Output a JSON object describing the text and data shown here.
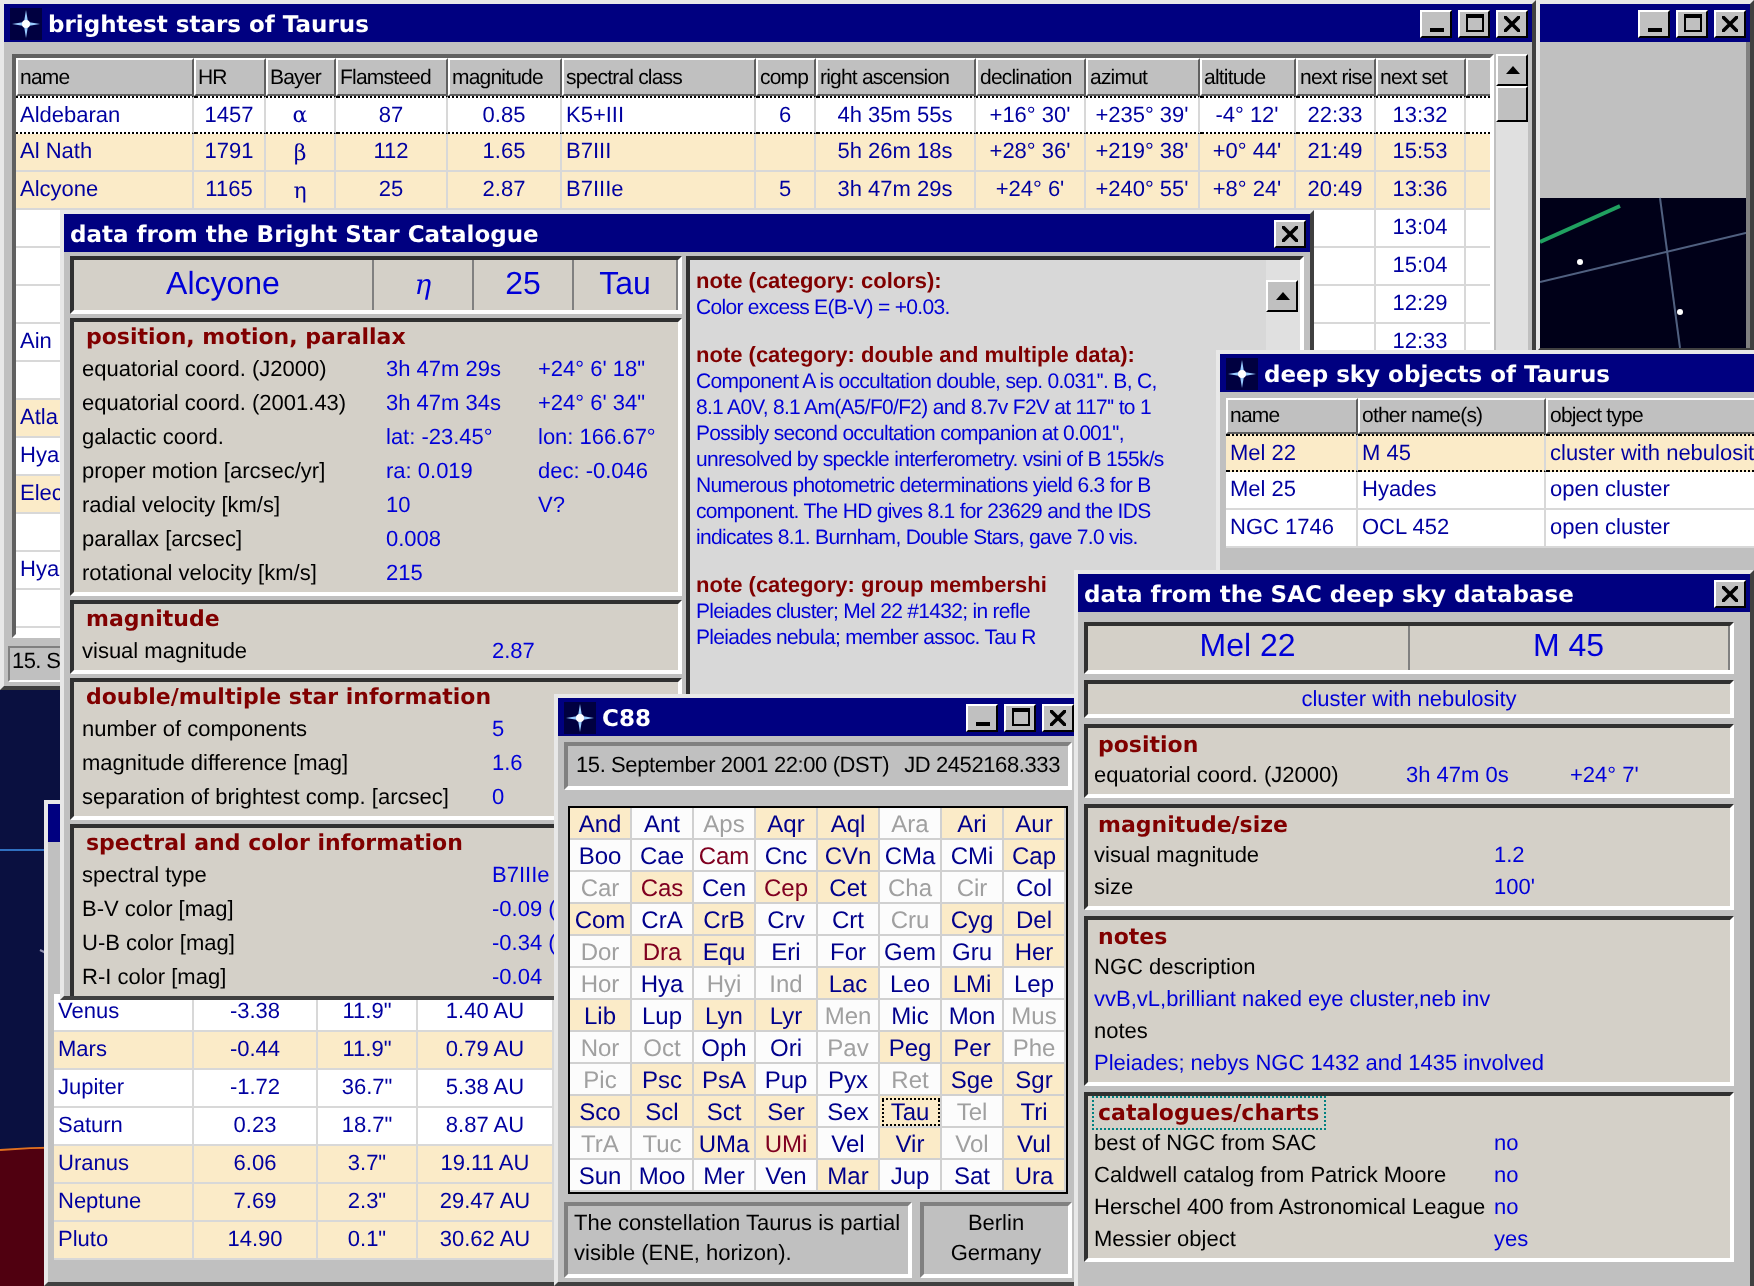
{
  "stars_window": {
    "title": "brightest stars of Taurus",
    "columns": [
      "name",
      "HR",
      "Bayer",
      "Flamsteed",
      "magnitude",
      "spectral class",
      "comp",
      "right ascension",
      "declination",
      "azimut",
      "altitude",
      "next rise",
      "next set"
    ],
    "rows": [
      {
        "selected": true,
        "shaded": false,
        "cells": [
          "Aldebaran",
          "1457",
          "α",
          "87",
          "0.85",
          "K5+III",
          "6",
          "4h 35m 55s",
          "+16° 30'",
          "+235° 39'",
          "-4° 12'",
          "22:33",
          "13:32"
        ]
      },
      {
        "selected": false,
        "shaded": true,
        "cells": [
          "Al Nath",
          "1791",
          "β",
          "112",
          "1.65",
          "B7III",
          null,
          "5h 26m 18s",
          "+28° 36'",
          "+219° 38'",
          "+0° 44'",
          "21:49",
          "15:53"
        ]
      },
      {
        "selected": false,
        "shaded": true,
        "cells": [
          "Alcyone",
          "1165",
          "η",
          "25",
          "2.87",
          "B7IIIe",
          "5",
          "3h 47m 29s",
          "+24° 6'",
          "+240° 55'",
          "+8° 24'",
          "20:49",
          "13:36"
        ]
      },
      {
        "selected": false,
        "shaded": false,
        "cells": [
          null,
          null,
          null,
          null,
          null,
          null,
          null,
          null,
          null,
          null,
          null,
          null,
          "13:04"
        ]
      },
      {
        "selected": false,
        "shaded": false,
        "cells": [
          null,
          null,
          null,
          null,
          null,
          null,
          null,
          null,
          null,
          null,
          null,
          null,
          "15:04"
        ]
      },
      {
        "selected": false,
        "shaded": false,
        "cells": [
          null,
          null,
          null,
          null,
          null,
          null,
          null,
          null,
          null,
          null,
          null,
          null,
          "12:29"
        ]
      },
      {
        "selected": false,
        "shaded": false,
        "cells": [
          "Ain",
          null,
          null,
          null,
          null,
          null,
          null,
          null,
          null,
          null,
          null,
          null,
          "12:33"
        ]
      },
      {
        "selected": false,
        "shaded": false,
        "cells": []
      },
      {
        "selected": false,
        "shaded": true,
        "cells": [
          "Atla"
        ]
      },
      {
        "selected": false,
        "shaded": false,
        "cells": [
          "Hya"
        ]
      },
      {
        "selected": false,
        "shaded": true,
        "cells": [
          "Elec"
        ]
      },
      {
        "selected": false,
        "shaded": false,
        "cells": []
      },
      {
        "selected": false,
        "shaded": false,
        "cells": [
          "Hya"
        ]
      },
      {
        "selected": false,
        "shaded": false,
        "cells": []
      }
    ],
    "status": "15. S"
  },
  "planets_window": {
    "rows": [
      {
        "shaded": false,
        "cells": [
          "Venus",
          "-3.38",
          "11.9\"",
          "1.40 AU"
        ]
      },
      {
        "shaded": true,
        "cells": [
          "Mars",
          "-0.44",
          "11.9\"",
          "0.79 AU"
        ]
      },
      {
        "shaded": false,
        "cells": [
          "Jupiter",
          "-1.72",
          "36.7\"",
          "5.38 AU"
        ]
      },
      {
        "shaded": false,
        "cells": [
          "Saturn",
          "0.23",
          "18.7\"",
          "8.87 AU"
        ]
      },
      {
        "shaded": true,
        "cells": [
          "Uranus",
          "6.06",
          "3.7\"",
          "19.11 AU"
        ]
      },
      {
        "shaded": true,
        "cells": [
          "Neptune",
          "7.69",
          "2.3\"",
          "29.47 AU"
        ]
      },
      {
        "shaded": true,
        "cells": [
          "Pluto",
          "14.90",
          "0.1\"",
          "30.62 AU"
        ]
      }
    ]
  },
  "bsc_window": {
    "title": "data from the Bright Star Catalogue",
    "header": [
      "Alcyone",
      "η",
      "25",
      "Tau"
    ],
    "sections": [
      {
        "heading": "position, motion, parallax",
        "rows": [
          [
            "equatorial coord. (J2000)",
            "3h 47m 29s",
            "+24° 6' 18\""
          ],
          [
            "equatorial coord. (2001.43)",
            "3h 47m 34s",
            "+24° 6' 34\""
          ],
          [
            "galactic coord.",
            "lat: -23.45°",
            "lon: 166.67°"
          ],
          [
            "proper motion [arcsec/yr]",
            "ra: 0.019",
            "dec: -0.046"
          ],
          [
            "radial velocity [km/s]",
            "10",
            "V?"
          ],
          [
            "parallax [arcsec]",
            "0.008"
          ],
          [
            "rotational velocity [km/s]",
            "215"
          ]
        ]
      },
      {
        "heading": "magnitude",
        "rows": [
          [
            "visual magnitude",
            "2.87"
          ]
        ]
      },
      {
        "heading": "double/multiple star information",
        "rows": [
          [
            "number of components",
            "5"
          ],
          [
            "magnitude difference [mag]",
            "1.6"
          ],
          [
            "separation of brightest comp. [arcsec]",
            "0"
          ]
        ]
      },
      {
        "heading": "spectral and color information",
        "rows": [
          [
            "spectral type",
            "B7IIIe"
          ],
          [
            "B-V color [mag]",
            "-0.09 ("
          ],
          [
            "U-B color [mag]",
            "-0.34 ("
          ],
          [
            "R-I color [mag]",
            "-0.04"
          ]
        ]
      }
    ],
    "notes": [
      {
        "heading": "note (category: colors):",
        "lines": [
          "Color excess E(B-V) = +0.03."
        ]
      },
      {
        "heading": "note (category: double and multiple data):",
        "lines": [
          "Component A is occultation double, sep. 0.031''. B, C,",
          "8.1 A0V, 8.1 Am(A5/F0/F2) and 8.7v F2V at 117'' to 1",
          "Possibly second occultation companion at 0.001'',",
          "unresolved by speckle interferometry. vsini of B 155k/s",
          "Numerous photometric determinations yield 6.3 for B",
          "component.  The HD gives 8.1 for 23629 and the IDS",
          "indicates 8.1.  Burnham, Double Stars, gave 7.0 vis."
        ]
      },
      {
        "heading": "note (category: group membershi",
        "lines": [
          "Pleiades cluster; Mel 22 #1432; in refle",
          "Pleiades nebula; member assoc. Tau R"
        ]
      }
    ]
  },
  "deepsky_window": {
    "title": "deep sky objects of Taurus",
    "columns": [
      "name",
      "other name(s)",
      "object type"
    ],
    "rows": [
      {
        "selected": true,
        "shaded": true,
        "cells": [
          "Mel  22",
          "M  45",
          "cluster with nebulosit"
        ]
      },
      {
        "selected": false,
        "shaded": false,
        "cells": [
          "Mel  25",
          "Hyades",
          "open cluster"
        ]
      },
      {
        "selected": false,
        "shaded": false,
        "cells": [
          "NGC 1746",
          "OCL  452",
          "open cluster"
        ]
      }
    ]
  },
  "sac_window": {
    "title": "data from the SAC deep sky database",
    "header": [
      "Mel  22",
      "M  45"
    ],
    "object_type": "cluster with nebulosity",
    "sections": [
      {
        "heading": "position",
        "focused": false,
        "rows": [
          {
            "kind": "triple",
            "cells": [
              "equatorial coord. (J2000)",
              "3h 47m 0s",
              "+24° 7'"
            ]
          }
        ]
      },
      {
        "heading": "magnitude/size",
        "focused": false,
        "rows": [
          {
            "kind": "pair",
            "cells": [
              "visual magnitude",
              "1.2"
            ]
          },
          {
            "kind": "pair",
            "cells": [
              "size",
              "100'"
            ]
          }
        ]
      },
      {
        "heading": "notes",
        "focused": false,
        "rows": [
          {
            "kind": "caption",
            "cells": [
              "NGC description"
            ]
          },
          {
            "kind": "value",
            "cells": [
              "vvB,vL,brilliant naked eye cluster,neb inv"
            ]
          },
          {
            "kind": "caption",
            "cells": [
              "notes"
            ]
          },
          {
            "kind": "value",
            "cells": [
              "Pleiades; nebys NGC 1432 and 1435 involved"
            ]
          }
        ]
      },
      {
        "heading": "catalogues/charts",
        "focused": true,
        "rows": [
          {
            "kind": "wide",
            "cells": [
              "best of NGC from SAC",
              "no"
            ]
          },
          {
            "kind": "wide",
            "cells": [
              "Caldwell catalog from Patrick Moore",
              "no"
            ]
          },
          {
            "kind": "wide",
            "cells": [
              "Herschel 400 from Astronomical League",
              "no"
            ]
          },
          {
            "kind": "wide",
            "cells": [
              "Messier object",
              "yes"
            ]
          }
        ]
      }
    ]
  },
  "c88_window": {
    "title": "C88",
    "date": "15. September 2001 22:00 (DST)",
    "julian_date": "JD 2452168.333",
    "cells": [
      {
        "label": "And",
        "dimmed": false,
        "emphasized": false,
        "shaded": true,
        "selected": false
      },
      {
        "label": "Ant",
        "dimmed": false,
        "emphasized": false,
        "shaded": false,
        "selected": false
      },
      {
        "label": "Aps",
        "dimmed": true,
        "emphasized": false,
        "shaded": false,
        "selected": false
      },
      {
        "label": "Aqr",
        "dimmed": false,
        "emphasized": false,
        "shaded": true,
        "selected": false
      },
      {
        "label": "Aql",
        "dimmed": false,
        "emphasized": false,
        "shaded": true,
        "selected": false
      },
      {
        "label": "Ara",
        "dimmed": true,
        "emphasized": false,
        "shaded": false,
        "selected": false
      },
      {
        "label": "Ari",
        "dimmed": false,
        "emphasized": false,
        "shaded": true,
        "selected": false
      },
      {
        "label": "Aur",
        "dimmed": false,
        "emphasized": false,
        "shaded": true,
        "selected": false
      },
      {
        "label": "Boo",
        "dimmed": false,
        "emphasized": false,
        "shaded": false,
        "selected": false
      },
      {
        "label": "Cae",
        "dimmed": false,
        "emphasized": false,
        "shaded": false,
        "selected": false
      },
      {
        "label": "Cam",
        "dimmed": false,
        "emphasized": true,
        "shaded": false,
        "selected": false
      },
      {
        "label": "Cnc",
        "dimmed": false,
        "emphasized": false,
        "shaded": false,
        "selected": false
      },
      {
        "label": "CVn",
        "dimmed": false,
        "emphasized": false,
        "shaded": true,
        "selected": false
      },
      {
        "label": "CMa",
        "dimmed": false,
        "emphasized": false,
        "shaded": false,
        "selected": false
      },
      {
        "label": "CMi",
        "dimmed": false,
        "emphasized": false,
        "shaded": false,
        "selected": false
      },
      {
        "label": "Cap",
        "dimmed": false,
        "emphasized": false,
        "shaded": true,
        "selected": false
      },
      {
        "label": "Car",
        "dimmed": true,
        "emphasized": false,
        "shaded": false,
        "selected": false
      },
      {
        "label": "Cas",
        "dimmed": false,
        "emphasized": true,
        "shaded": true,
        "selected": false
      },
      {
        "label": "Cen",
        "dimmed": false,
        "emphasized": false,
        "shaded": false,
        "selected": false
      },
      {
        "label": "Cep",
        "dimmed": false,
        "emphasized": true,
        "shaded": true,
        "selected": false
      },
      {
        "label": "Cet",
        "dimmed": false,
        "emphasized": false,
        "shaded": true,
        "selected": false
      },
      {
        "label": "Cha",
        "dimmed": true,
        "emphasized": false,
        "shaded": false,
        "selected": false
      },
      {
        "label": "Cir",
        "dimmed": true,
        "emphasized": false,
        "shaded": false,
        "selected": false
      },
      {
        "label": "Col",
        "dimmed": false,
        "emphasized": false,
        "shaded": false,
        "selected": false
      },
      {
        "label": "Com",
        "dimmed": false,
        "emphasized": false,
        "shaded": true,
        "selected": false
      },
      {
        "label": "CrA",
        "dimmed": false,
        "emphasized": false,
        "shaded": false,
        "selected": false
      },
      {
        "label": "CrB",
        "dimmed": false,
        "emphasized": false,
        "shaded": true,
        "selected": false
      },
      {
        "label": "Crv",
        "dimmed": false,
        "emphasized": false,
        "shaded": false,
        "selected": false
      },
      {
        "label": "Crt",
        "dimmed": false,
        "emphasized": false,
        "shaded": false,
        "selected": false
      },
      {
        "label": "Cru",
        "dimmed": true,
        "emphasized": false,
        "shaded": false,
        "selected": false
      },
      {
        "label": "Cyg",
        "dimmed": false,
        "emphasized": false,
        "shaded": true,
        "selected": false
      },
      {
        "label": "Del",
        "dimmed": false,
        "emphasized": false,
        "shaded": true,
        "selected": false
      },
      {
        "label": "Dor",
        "dimmed": true,
        "emphasized": false,
        "shaded": false,
        "selected": false
      },
      {
        "label": "Dra",
        "dimmed": false,
        "emphasized": true,
        "shaded": true,
        "selected": false
      },
      {
        "label": "Equ",
        "dimmed": false,
        "emphasized": false,
        "shaded": true,
        "selected": false
      },
      {
        "label": "Eri",
        "dimmed": false,
        "emphasized": false,
        "shaded": false,
        "selected": false
      },
      {
        "label": "For",
        "dimmed": false,
        "emphasized": false,
        "shaded": false,
        "selected": false
      },
      {
        "label": "Gem",
        "dimmed": false,
        "emphasized": false,
        "shaded": false,
        "selected": false
      },
      {
        "label": "Gru",
        "dimmed": false,
        "emphasized": false,
        "shaded": false,
        "selected": false
      },
      {
        "label": "Her",
        "dimmed": false,
        "emphasized": false,
        "shaded": true,
        "selected": false
      },
      {
        "label": "Hor",
        "dimmed": true,
        "emphasized": false,
        "shaded": false,
        "selected": false
      },
      {
        "label": "Hya",
        "dimmed": false,
        "emphasized": false,
        "shaded": false,
        "selected": false
      },
      {
        "label": "Hyi",
        "dimmed": true,
        "emphasized": false,
        "shaded": false,
        "selected": false
      },
      {
        "label": "Ind",
        "dimmed": true,
        "emphasized": false,
        "shaded": false,
        "selected": false
      },
      {
        "label": "Lac",
        "dimmed": false,
        "emphasized": false,
        "shaded": true,
        "selected": false
      },
      {
        "label": "Leo",
        "dimmed": false,
        "emphasized": false,
        "shaded": false,
        "selected": false
      },
      {
        "label": "LMi",
        "dimmed": false,
        "emphasized": false,
        "shaded": true,
        "selected": false
      },
      {
        "label": "Lep",
        "dimmed": false,
        "emphasized": false,
        "shaded": false,
        "selected": false
      },
      {
        "label": "Lib",
        "dimmed": false,
        "emphasized": false,
        "shaded": true,
        "selected": false
      },
      {
        "label": "Lup",
        "dimmed": false,
        "emphasized": false,
        "shaded": false,
        "selected": false
      },
      {
        "label": "Lyn",
        "dimmed": false,
        "emphasized": false,
        "shaded": true,
        "selected": false
      },
      {
        "label": "Lyr",
        "dimmed": false,
        "emphasized": false,
        "shaded": true,
        "selected": false
      },
      {
        "label": "Men",
        "dimmed": true,
        "emphasized": false,
        "shaded": false,
        "selected": false
      },
      {
        "label": "Mic",
        "dimmed": false,
        "emphasized": false,
        "shaded": false,
        "selected": false
      },
      {
        "label": "Mon",
        "dimmed": false,
        "emphasized": false,
        "shaded": false,
        "selected": false
      },
      {
        "label": "Mus",
        "dimmed": true,
        "emphasized": false,
        "shaded": false,
        "selected": false
      },
      {
        "label": "Nor",
        "dimmed": true,
        "emphasized": false,
        "shaded": false,
        "selected": false
      },
      {
        "label": "Oct",
        "dimmed": true,
        "emphasized": false,
        "shaded": false,
        "selected": false
      },
      {
        "label": "Oph",
        "dimmed": false,
        "emphasized": false,
        "shaded": false,
        "selected": false
      },
      {
        "label": "Ori",
        "dimmed": false,
        "emphasized": false,
        "shaded": false,
        "selected": false
      },
      {
        "label": "Pav",
        "dimmed": true,
        "emphasized": false,
        "shaded": false,
        "selected": false
      },
      {
        "label": "Peg",
        "dimmed": false,
        "emphasized": false,
        "shaded": true,
        "selected": false
      },
      {
        "label": "Per",
        "dimmed": false,
        "emphasized": false,
        "shaded": true,
        "selected": false
      },
      {
        "label": "Phe",
        "dimmed": true,
        "emphasized": false,
        "shaded": false,
        "selected": false
      },
      {
        "label": "Pic",
        "dimmed": true,
        "emphasized": false,
        "shaded": false,
        "selected": false
      },
      {
        "label": "Psc",
        "dimmed": false,
        "emphasized": false,
        "shaded": true,
        "selected": false
      },
      {
        "label": "PsA",
        "dimmed": false,
        "emphasized": false,
        "shaded": true,
        "selected": false
      },
      {
        "label": "Pup",
        "dimmed": false,
        "emphasized": false,
        "shaded": false,
        "selected": false
      },
      {
        "label": "Pyx",
        "dimmed": false,
        "emphasized": false,
        "shaded": false,
        "selected": false
      },
      {
        "label": "Ret",
        "dimmed": true,
        "emphasized": false,
        "shaded": false,
        "selected": false
      },
      {
        "label": "Sge",
        "dimmed": false,
        "emphasized": false,
        "shaded": true,
        "selected": false
      },
      {
        "label": "Sgr",
        "dimmed": false,
        "emphasized": false,
        "shaded": true,
        "selected": false
      },
      {
        "label": "Sco",
        "dimmed": false,
        "emphasized": false,
        "shaded": true,
        "selected": false
      },
      {
        "label": "Scl",
        "dimmed": false,
        "emphasized": false,
        "shaded": true,
        "selected": false
      },
      {
        "label": "Sct",
        "dimmed": false,
        "emphasized": false,
        "shaded": true,
        "selected": false
      },
      {
        "label": "Ser",
        "dimmed": false,
        "emphasized": false,
        "shaded": true,
        "selected": false
      },
      {
        "label": "Sex",
        "dimmed": false,
        "emphasized": false,
        "shaded": false,
        "selected": false
      },
      {
        "label": "Tau",
        "dimmed": false,
        "emphasized": false,
        "shaded": true,
        "selected": true
      },
      {
        "label": "Tel",
        "dimmed": true,
        "emphasized": false,
        "shaded": false,
        "selected": false
      },
      {
        "label": "Tri",
        "dimmed": false,
        "emphasized": false,
        "shaded": true,
        "selected": false
      },
      {
        "label": "TrA",
        "dimmed": true,
        "emphasized": false,
        "shaded": false,
        "selected": false
      },
      {
        "label": "Tuc",
        "dimmed": true,
        "emphasized": false,
        "shaded": false,
        "selected": false
      },
      {
        "label": "UMa",
        "dimmed": false,
        "emphasized": false,
        "shaded": true,
        "selected": false
      },
      {
        "label": "UMi",
        "dimmed": false,
        "emphasized": true,
        "shaded": true,
        "selected": false
      },
      {
        "label": "Vel",
        "dimmed": false,
        "emphasized": false,
        "shaded": false,
        "selected": false
      },
      {
        "label": "Vir",
        "dimmed": false,
        "emphasized": false,
        "shaded": true,
        "selected": false
      },
      {
        "label": "Vol",
        "dimmed": true,
        "emphasized": false,
        "shaded": false,
        "selected": false
      },
      {
        "label": "Vul",
        "dimmed": false,
        "emphasized": false,
        "shaded": true,
        "selected": false
      },
      {
        "label": "Sun",
        "dimmed": false,
        "emphasized": false,
        "shaded": false,
        "selected": false
      },
      {
        "label": "Moo",
        "dimmed": false,
        "emphasized": false,
        "shaded": false,
        "selected": false
      },
      {
        "label": "Mer",
        "dimmed": false,
        "emphasized": false,
        "shaded": false,
        "selected": false
      },
      {
        "label": "Ven",
        "dimmed": false,
        "emphasized": false,
        "shaded": false,
        "selected": false
      },
      {
        "label": "Mar",
        "dimmed": false,
        "emphasized": false,
        "shaded": true,
        "selected": false
      },
      {
        "label": "Jup",
        "dimmed": false,
        "emphasized": false,
        "shaded": false,
        "selected": false
      },
      {
        "label": "Sat",
        "dimmed": false,
        "emphasized": false,
        "shaded": false,
        "selected": false
      },
      {
        "label": "Ura",
        "dimmed": false,
        "emphasized": false,
        "shaded": true,
        "selected": false
      }
    ],
    "visibility": "The constellation Taurus is partial visible (ENE, horizon).",
    "location": "Berlin Germany"
  }
}
